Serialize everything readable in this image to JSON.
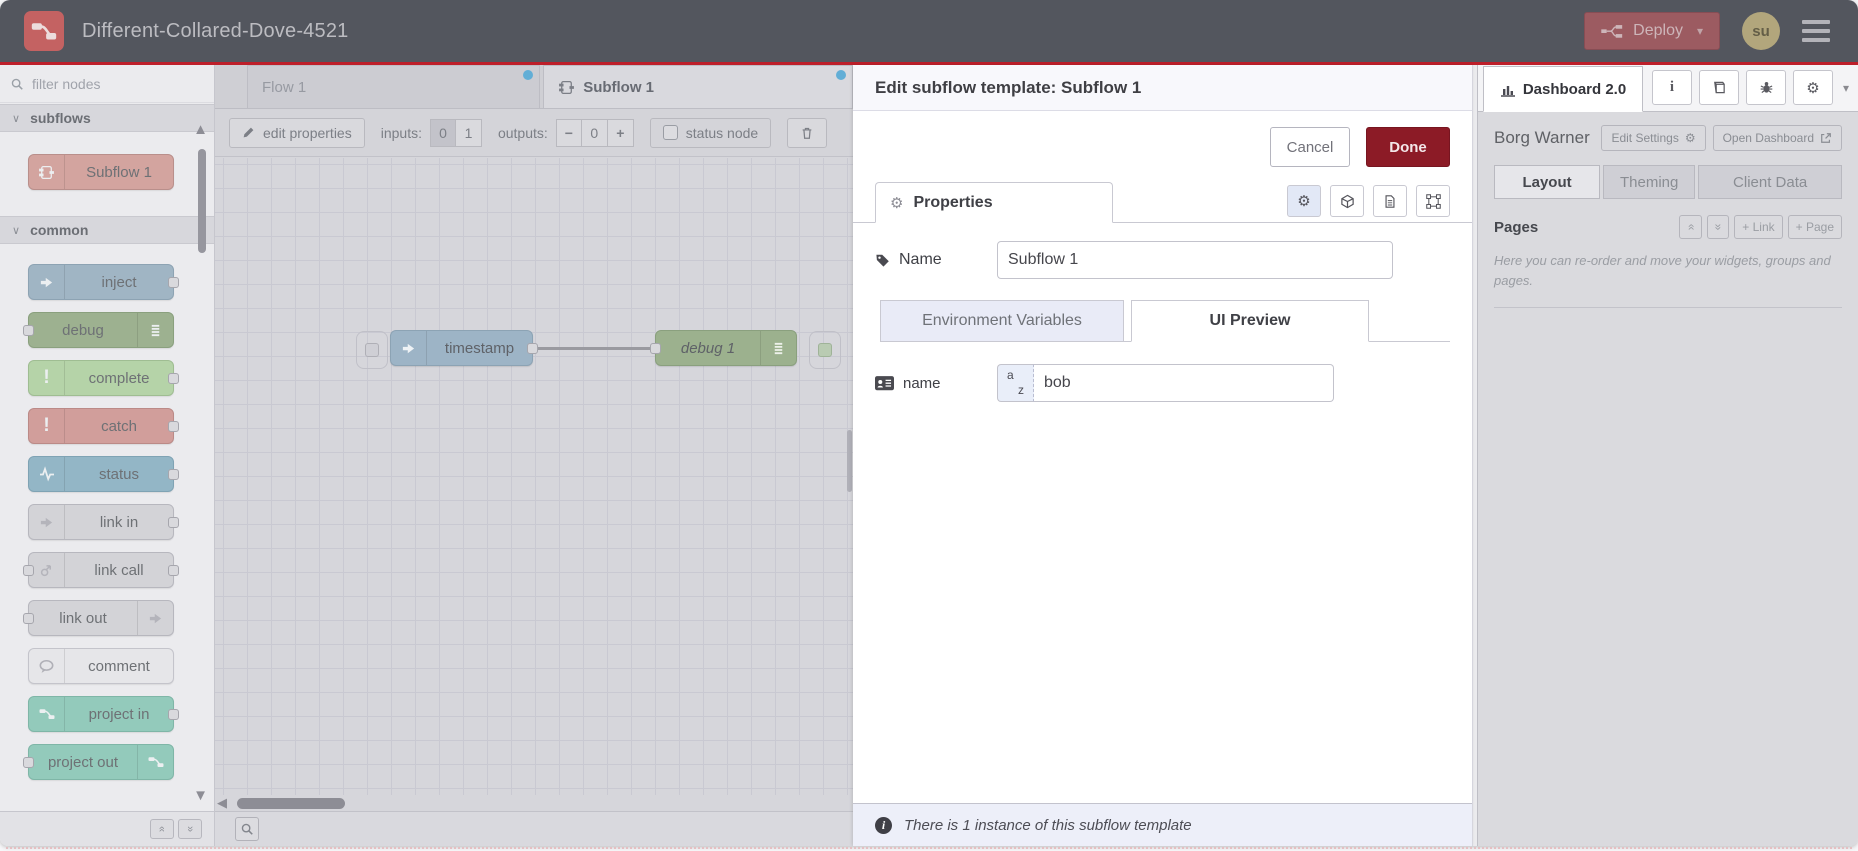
{
  "header": {
    "title": "Different-Collared-Dove-4521",
    "deploy_label": "Deploy",
    "avatar_initials": "su"
  },
  "palette": {
    "search_placeholder": "filter nodes",
    "categories": [
      {
        "label": "subflows",
        "nodes": [
          {
            "label": "Subflow 1"
          }
        ]
      },
      {
        "label": "common",
        "nodes": [
          {
            "label": "inject"
          },
          {
            "label": "debug"
          },
          {
            "label": "complete"
          },
          {
            "label": "catch"
          },
          {
            "label": "status"
          },
          {
            "label": "link in"
          },
          {
            "label": "link call"
          },
          {
            "label": "link out"
          },
          {
            "label": "comment"
          },
          {
            "label": "project in"
          },
          {
            "label": "project out"
          }
        ]
      }
    ]
  },
  "workspace": {
    "tabs": [
      {
        "label": "Flow 1"
      },
      {
        "label": "Subflow 1"
      }
    ],
    "toolbar": {
      "edit_properties": "edit properties",
      "inputs_label": "inputs:",
      "input_options": [
        "0",
        "1"
      ],
      "outputs_label": "outputs:",
      "outputs_minus": "−",
      "outputs_value": "0",
      "outputs_plus": "+",
      "status_node_label": "status node"
    },
    "canvas": {
      "nodes": [
        {
          "label": "timestamp"
        },
        {
          "label": "debug 1"
        }
      ]
    }
  },
  "dialog": {
    "title": "Edit subflow template: Subflow 1",
    "cancel_label": "Cancel",
    "done_label": "Done",
    "properties_tab": "Properties",
    "name_label": "Name",
    "name_value": "Subflow 1",
    "tab_env": "Environment Variables",
    "tab_ui": "UI Preview",
    "field_label": "name",
    "prefix_a": "a",
    "prefix_z": "z",
    "field_value": "bob",
    "footer_text": "There is 1 instance of this subflow template"
  },
  "sidebar": {
    "tab_label": "Dashboard 2.0",
    "project_name": "Borg Warner",
    "edit_settings_label": "Edit Settings",
    "open_dashboard_label": "Open Dashboard",
    "tabs": [
      {
        "label": "Layout"
      },
      {
        "label": "Theming"
      },
      {
        "label": "Client Data"
      }
    ],
    "pages_title": "Pages",
    "link_button": "+ Link",
    "page_button": "+ Page",
    "description": "Here you can re-order and move your widgets, groups and pages."
  },
  "icons": {
    "gear": "⚙",
    "chevron_down": "∨",
    "caret_down": "▾",
    "up_arrow": "▲",
    "down_arrow": "▼",
    "left_arrow": "◀",
    "double_chevron": "»",
    "info": "i",
    "exclamation": "!"
  },
  "colors": {
    "accent_red": "#bd1f2a",
    "done_button": "#8c1b26",
    "deploy_dimmed": "#9c5b61",
    "tab_dot_blue": "#62aed6",
    "node_subflow": "#d3a49f",
    "node_inject": "#a0b5c4",
    "node_debug": "#9db190",
    "node_complete": "#b5d3a8",
    "node_catch": "#d19e9b",
    "node_status": "#93b6c6",
    "node_link": "#d3d3d7",
    "node_comment": "#e6e6e9",
    "node_project": "#93cabb"
  }
}
